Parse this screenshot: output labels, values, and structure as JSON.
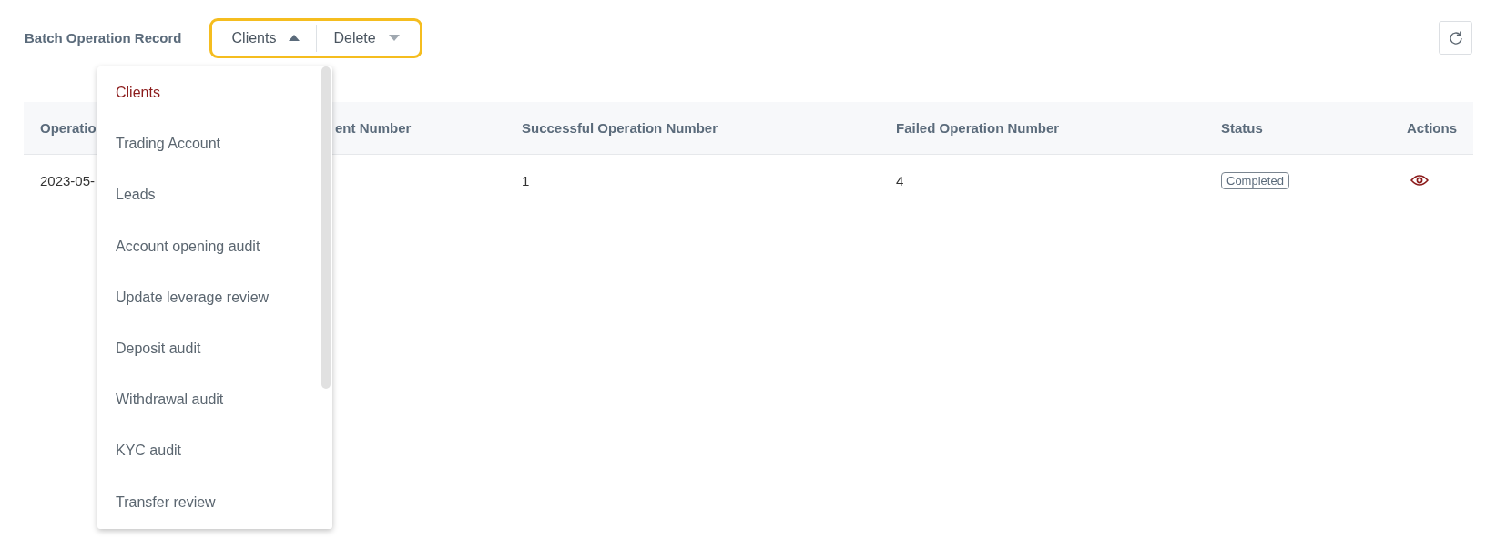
{
  "header": {
    "title": "Batch Operation Record",
    "selectors": [
      {
        "label": "Clients",
        "expanded": true
      },
      {
        "label": "Delete",
        "expanded": false
      }
    ]
  },
  "dropdown": {
    "items": [
      {
        "label": "Clients",
        "selected": true
      },
      {
        "label": "Trading Account",
        "selected": false
      },
      {
        "label": "Leads",
        "selected": false
      },
      {
        "label": "Account opening audit",
        "selected": false
      },
      {
        "label": "Update leverage review",
        "selected": false
      },
      {
        "label": "Deposit audit",
        "selected": false
      },
      {
        "label": "Withdrawal audit",
        "selected": false
      },
      {
        "label": "KYC audit",
        "selected": false
      },
      {
        "label": "Transfer review",
        "selected": false
      }
    ]
  },
  "table": {
    "columns": [
      "Operatio",
      "ent Number",
      "Successful Operation Number",
      "Failed Operation Number",
      "Status",
      "Actions"
    ],
    "rows": [
      {
        "column_1": "2023-05-",
        "successful": "1",
        "failed": "4",
        "status": "Completed"
      }
    ]
  }
}
